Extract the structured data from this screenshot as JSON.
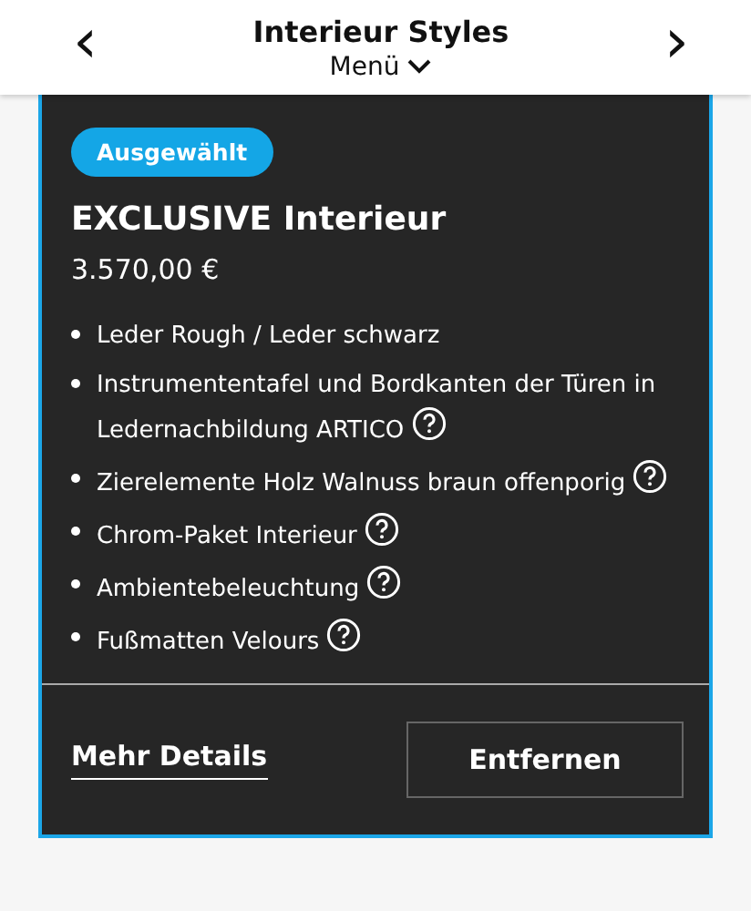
{
  "header": {
    "title": "Interieur Styles",
    "menu": "Menü",
    "prev": "‹",
    "next": "›"
  },
  "card": {
    "selected": true,
    "badge": "Ausgewählt",
    "title": "EXCLUSIVE Interieur",
    "price": "3.570,00 €",
    "features": [
      {
        "text": "Leder Rough / Leder schwarz",
        "info": false
      },
      {
        "text": "Instrumententafel und Bordkanten der Türen in Ledernachbildung ARTICO",
        "info": true
      },
      {
        "text": "Zierelemente Holz Walnuss braun offenporig",
        "info": true
      },
      {
        "text": "Chrom-Paket Interieur",
        "info": true
      },
      {
        "text": "Ambientebeleuchtung",
        "info": true
      },
      {
        "text": "Fußmatten Velours",
        "info": true
      }
    ],
    "details_link": "Mehr Details",
    "remove_button": "Entfernen"
  }
}
